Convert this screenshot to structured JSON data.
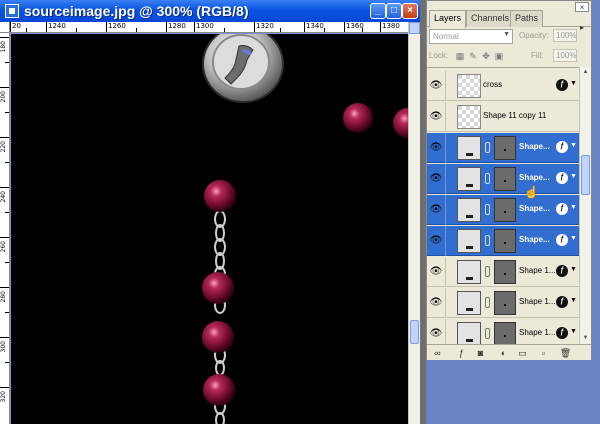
{
  "document": {
    "title": "sourceimage.jpg @ 300% (RGB/8)",
    "window_buttons": [
      "minimize",
      "maximize",
      "close"
    ],
    "ruler_top_labels": [
      "20",
      "1240",
      "1260",
      "1280",
      "1300",
      "1320",
      "1340",
      "1360",
      "1380"
    ],
    "ruler_left_labels": [
      "180",
      "200",
      "220",
      "240",
      "260",
      "280",
      "300",
      "320"
    ]
  },
  "layers_panel": {
    "tabs": [
      "Layers",
      "Channels",
      "Paths"
    ],
    "active_tab": "Layers",
    "blend_mode": "Normal",
    "opacity_label": "Opacity:",
    "opacity_value": "100%",
    "lock_label": "Lock:",
    "fill_label": "Fill:",
    "fill_value": "100%",
    "layers": [
      {
        "name": "cross",
        "type": "pixel",
        "selected": false,
        "visible": true,
        "has_fx": true
      },
      {
        "name": "Shape 11 copy 11",
        "type": "pixel",
        "selected": false,
        "visible": true,
        "has_fx": false
      },
      {
        "name": "Shape...",
        "type": "shape",
        "selected": true,
        "visible": true,
        "has_fx": true
      },
      {
        "name": "Shape...",
        "type": "shape",
        "selected": true,
        "visible": true,
        "has_fx": true
      },
      {
        "name": "Shape...",
        "type": "shape",
        "selected": true,
        "visible": true,
        "has_fx": true
      },
      {
        "name": "Shape...",
        "type": "shape",
        "selected": true,
        "visible": true,
        "has_fx": true
      },
      {
        "name": "Shape 1...",
        "type": "shape",
        "selected": false,
        "visible": true,
        "has_fx": true
      },
      {
        "name": "Shape 1...",
        "type": "shape",
        "selected": false,
        "visible": true,
        "has_fx": true
      },
      {
        "name": "Shape 1...",
        "type": "shape",
        "selected": false,
        "visible": true,
        "has_fx": true
      }
    ],
    "bottom_icons": [
      "link-layers-icon",
      "layer-style-icon",
      "add-mask-icon",
      "adjustment-layer-icon",
      "new-group-icon",
      "new-layer-icon",
      "delete-layer-icon"
    ]
  },
  "colors": {
    "titlebar_blue": "#0a54e3",
    "selection_blue": "#326ed0",
    "bead": "#7a1030",
    "canvas": "#000000"
  }
}
